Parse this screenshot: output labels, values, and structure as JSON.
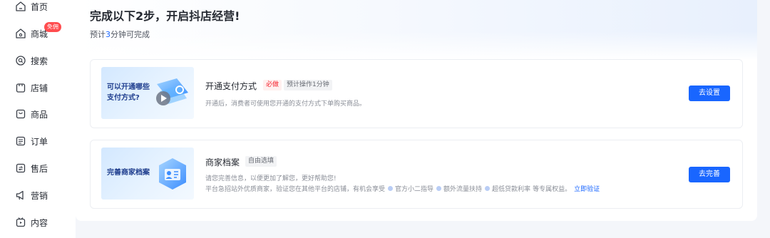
{
  "sidebar": {
    "items": [
      {
        "label": "首页",
        "icon": "home-icon"
      },
      {
        "label": "商城",
        "icon": "mall-icon",
        "badge": "免佣"
      },
      {
        "label": "搜索",
        "icon": "search-icon"
      },
      {
        "label": "店铺",
        "icon": "store-icon"
      },
      {
        "label": "商品",
        "icon": "product-icon"
      },
      {
        "label": "订单",
        "icon": "order-icon"
      },
      {
        "label": "售后",
        "icon": "after-sales-icon"
      },
      {
        "label": "营销",
        "icon": "marketing-icon"
      },
      {
        "label": "内容",
        "icon": "content-icon"
      }
    ]
  },
  "header": {
    "title": "完成以下2步，开启抖店经营!",
    "subtitle_prefix": "预计",
    "subtitle_highlight": "3",
    "subtitle_suffix": "分钟可完成"
  },
  "steps": [
    {
      "banner_line1": "可以开通哪些",
      "banner_line2": "支付方式?",
      "title": "开通支付方式",
      "tag_required": "必做",
      "tag_time": "预计操作1分钟",
      "desc": "开通后，消费者可使用您开通的支付方式下单购买商品。",
      "button": "去设置"
    },
    {
      "banner_line1": "完善商家档案",
      "title": "商家档案",
      "tag_optional": "自由选填",
      "desc_line1": "请您完善信息，以便更加了解您，更好帮助您!",
      "desc_line2": "平台急招站外优质商家，验证您在其他平台的店铺，有机会享受",
      "perks": [
        "官方小二指导",
        "额外流量扶持",
        "超低贷款利率"
      ],
      "perk_suffix": "等专属权益。",
      "link": "立即验证",
      "button": "去完善"
    }
  ],
  "colors": {
    "accent": "#1966ff",
    "badge": "#ff4d4f",
    "required_tag": "#f5222d"
  }
}
